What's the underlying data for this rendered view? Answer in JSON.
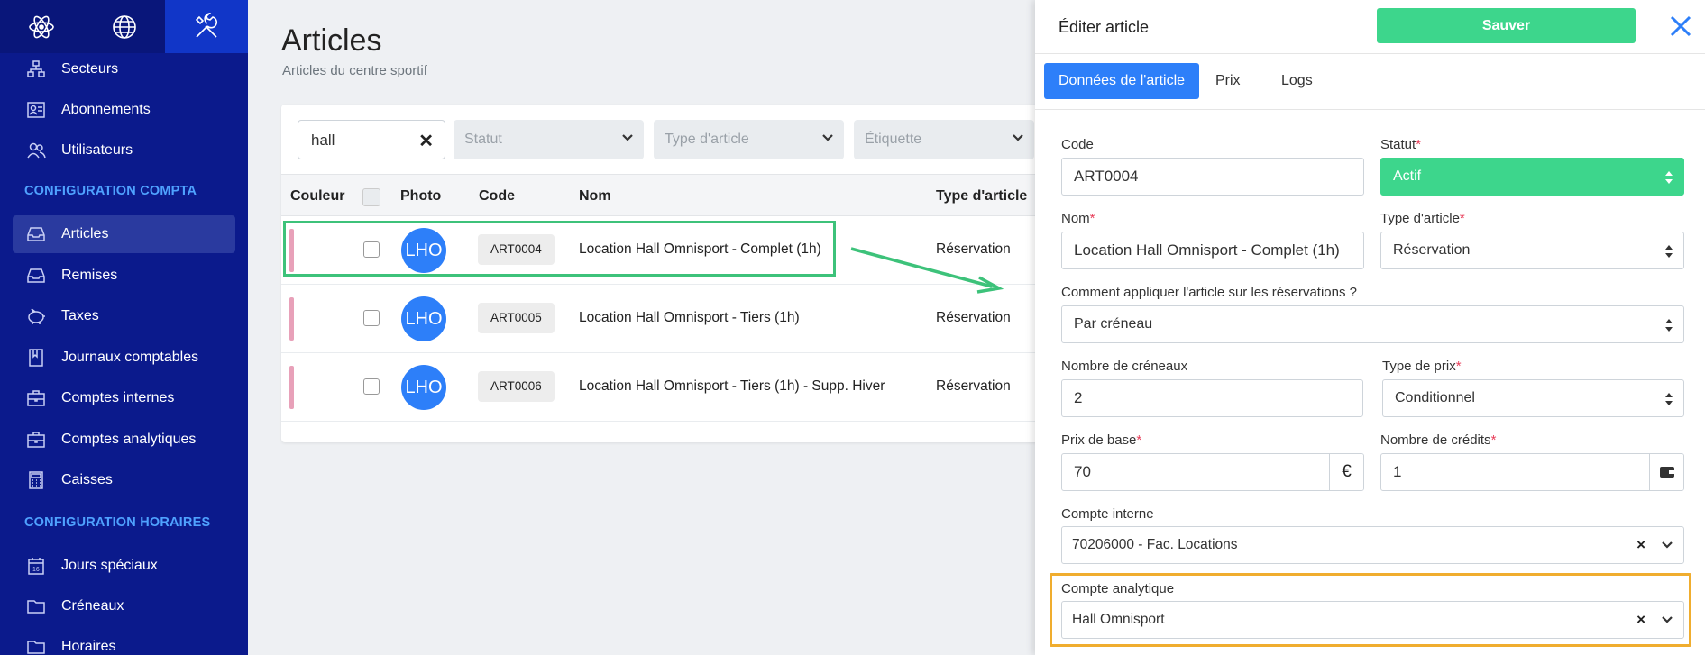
{
  "sidebar": {
    "top_tabs": [
      "atom-icon",
      "globe-icon",
      "tools-icon"
    ],
    "items_top": [
      {
        "label": "Secteurs",
        "icon": "sectors-icon"
      },
      {
        "label": "Abonnements",
        "icon": "id-card-icon"
      },
      {
        "label": "Utilisateurs",
        "icon": "users-icon"
      }
    ],
    "section_compta": "CONFIGURATION COMPTA",
    "items_compta": [
      {
        "label": "Articles",
        "icon": "inbox-icon",
        "active": true
      },
      {
        "label": "Remises",
        "icon": "inbox-icon"
      },
      {
        "label": "Taxes",
        "icon": "piggy-bank-icon"
      },
      {
        "label": "Journaux comptables",
        "icon": "book-icon"
      },
      {
        "label": "Comptes internes",
        "icon": "briefcase-icon"
      },
      {
        "label": "Comptes analytiques",
        "icon": "briefcase-icon"
      },
      {
        "label": "Caisses",
        "icon": "calculator-icon"
      }
    ],
    "section_horaires": "CONFIGURATION HORAIRES",
    "items_horaires": [
      {
        "label": "Jours spéciaux",
        "icon": "calendar-icon"
      },
      {
        "label": "Créneaux",
        "icon": "folder-icon"
      },
      {
        "label": "Horaires",
        "icon": "folder-icon"
      }
    ]
  },
  "main": {
    "title": "Articles",
    "subtitle": "Articles du centre sportif",
    "search_value": "hall",
    "filters": [
      "Statut",
      "Type d'article",
      "Étiquette"
    ],
    "columns": [
      "Couleur",
      "Photo",
      "Code",
      "Nom",
      "Type d'article"
    ],
    "rows": [
      {
        "avatar": "LHO",
        "code": "ART0004",
        "nom": "Location Hall Omnisport - Complet (1h)",
        "type": "Réservation"
      },
      {
        "avatar": "LHO",
        "code": "ART0005",
        "nom": "Location Hall Omnisport - Tiers (1h)",
        "type": "Réservation"
      },
      {
        "avatar": "LHO",
        "code": "ART0006",
        "nom": "Location Hall Omnisport - Tiers (1h) - Supp. Hiver",
        "type": "Réservation"
      }
    ]
  },
  "panel": {
    "title": "Éditer article",
    "save_label": "Sauver",
    "tabs": [
      "Données de l'article",
      "Prix",
      "Logs"
    ],
    "fields": {
      "code_label": "Code",
      "code_value": "ART0004",
      "statut_label": "Statut",
      "statut_value": "Actif",
      "nom_label": "Nom",
      "nom_value": "Location Hall Omnisport - Complet (1h)",
      "type_label": "Type d'article",
      "type_value": "Réservation",
      "apply_label": "Comment appliquer l'article sur les réservations ?",
      "apply_value": "Par créneau",
      "creneaux_label": "Nombre de créneaux",
      "creneaux_value": "2",
      "typeprix_label": "Type de prix",
      "typeprix_value": "Conditionnel",
      "prixbase_label": "Prix de base",
      "prixbase_value": "70",
      "currency": "€",
      "credits_label": "Nombre de crédits",
      "credits_value": "1",
      "compte_interne_label": "Compte interne",
      "compte_interne_value": "70206000 - Fac. Locations",
      "compte_analytique_label": "Compte analytique",
      "compte_analytique_value": "Hall Omnisport",
      "required_mark": "*"
    }
  },
  "colors": {
    "sidebar_bg": "#0b1a8c",
    "accent_blue": "#2d7ff9",
    "success_green": "#3dd68c",
    "highlight_green": "#3dc27a",
    "highlight_orange": "#f0ad2e",
    "row_color_bar": "#e8a1b9"
  }
}
